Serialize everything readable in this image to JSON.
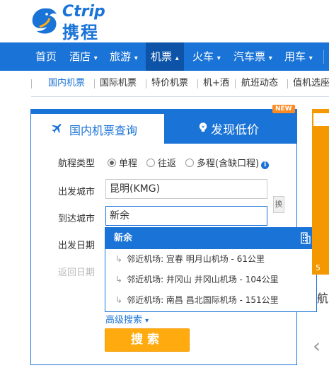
{
  "brand": {
    "name_en": "Ctrip",
    "name_cn": "携程"
  },
  "nav": {
    "items": [
      {
        "label": "首页",
        "arrow": ""
      },
      {
        "label": "酒店",
        "arrow": "▾"
      },
      {
        "label": "旅游",
        "arrow": "▾"
      },
      {
        "label": "机票",
        "arrow": "▴"
      },
      {
        "label": "火车",
        "arrow": "▾"
      },
      {
        "label": "汽车票",
        "arrow": "▾"
      },
      {
        "label": "用车",
        "arrow": "▾"
      }
    ],
    "active_index": 3
  },
  "subnav": {
    "items": [
      "国内机票",
      "国际机票",
      "特价机票",
      "机+酒",
      "航班动态",
      "值机选座"
    ],
    "active_index": 0
  },
  "search": {
    "tab_active": "国内机票查询",
    "tab_other": "发现低价",
    "new_badge": "NEW",
    "trip_type_label": "航程类型",
    "trip_types": [
      "单程",
      "往返",
      "多程(含缺口程)"
    ],
    "trip_type_selected": 0,
    "info_glyph": "i",
    "depart_city_label": "出发城市",
    "depart_city_value": "昆明(KMG)",
    "arrive_city_label": "到达城市",
    "arrive_city_value": "新余",
    "swap_label": "换",
    "depart_date_label": "出发日期",
    "return_date_label": "返回日期",
    "advanced_label": "高级搜索",
    "advanced_arrow": "▾",
    "search_button": "搜索"
  },
  "dropdown": {
    "header": "新余",
    "arrow_glyph": "↳",
    "rows": [
      "邻近机场: 宜春 明月山机场 - 61公里",
      "邻近机场: 井冈山 井冈山机场 - 104公里",
      "邻近机场: 南昌 昌北国际机场 - 151公里"
    ]
  },
  "side": {
    "number": "5",
    "text": "航",
    "arrow": "‹"
  },
  "colors": {
    "brand_blue": "#1a73d7",
    "orange": "#ffab10",
    "nav_active": "#0d54a8"
  }
}
